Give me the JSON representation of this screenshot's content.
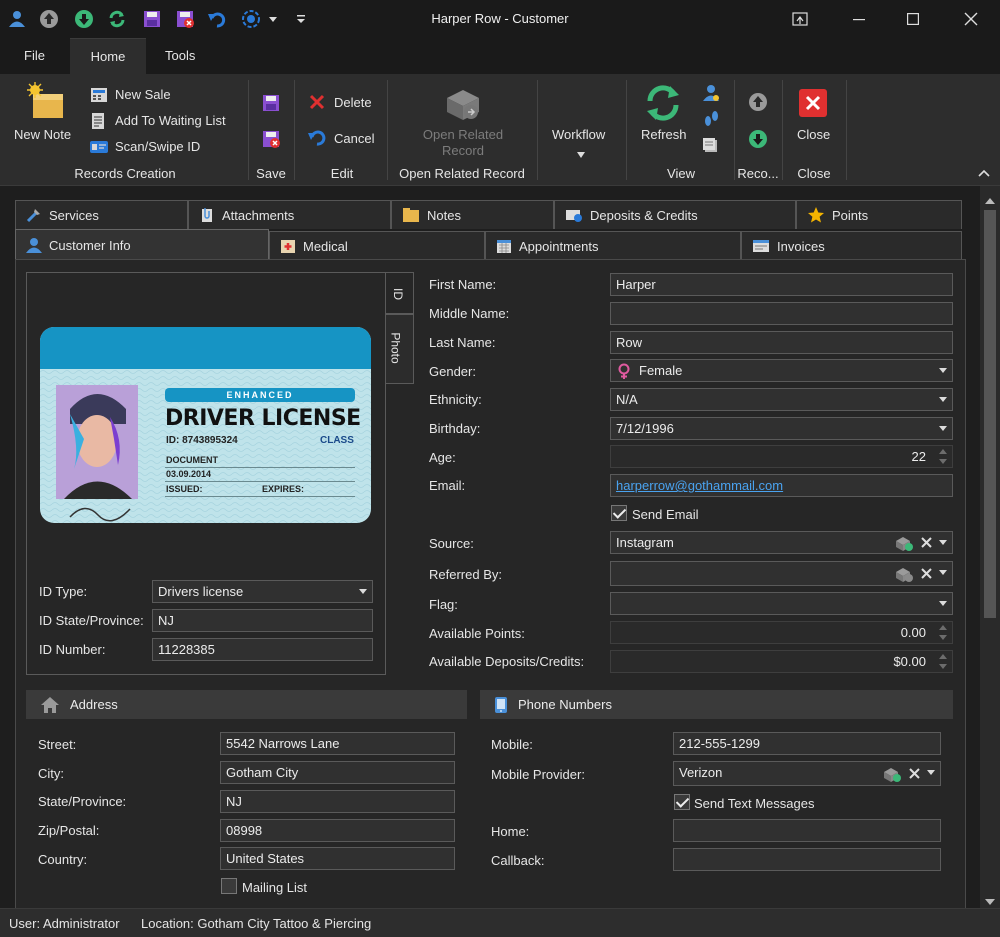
{
  "window": {
    "title": "Harper Row - Customer"
  },
  "menu_tabs": [
    "File",
    "Home",
    "Tools"
  ],
  "ribbon": {
    "new_note": "New Note",
    "new_sale": "New Sale",
    "add_to_waiting_list": "Add To Waiting List",
    "scan_swipe_id": "Scan/Swipe ID",
    "group_records_creation": "Records Creation",
    "group_save": "Save",
    "delete": "Delete",
    "cancel": "Cancel",
    "group_edit": "Edit",
    "open_related_record_line1": "Open Related",
    "open_related_record_line2": "Record",
    "group_open_related_record": "Open Related Record",
    "workflow": "Workflow",
    "refresh": "Refresh",
    "group_view": "View",
    "group_reco": "Reco...",
    "close": "Close",
    "group_close": "Close"
  },
  "tabs_row1": [
    "Services",
    "Attachments",
    "Notes",
    "Deposits & Credits",
    "Points"
  ],
  "tabs_row2": [
    "Customer Info",
    "Medical",
    "Appointments",
    "Invoices"
  ],
  "id_card": {
    "side_tab_id": "ID",
    "side_tab_photo": "Photo",
    "card_enhanced": "ENHANCED",
    "card_title": "DRIVER LICENSE",
    "card_id": "ID: 8743895324",
    "card_class": "CLASS",
    "card_document": "DOCUMENT",
    "card_date": "03.09.2014",
    "card_issued": "ISSUED:",
    "card_expires": "EXPIRES:",
    "id_type_label": "ID Type:",
    "id_type_value": "Drivers license",
    "id_state_label": "ID State/Province:",
    "id_state_value": "NJ",
    "id_number_label": "ID Number:",
    "id_number_value": "11228385"
  },
  "customer": {
    "first_name_label": "First Name:",
    "first_name": "Harper",
    "middle_name_label": "Middle Name:",
    "middle_name": "",
    "last_name_label": "Last Name:",
    "last_name": "Row",
    "gender_label": "Gender:",
    "gender": "Female",
    "ethnicity_label": "Ethnicity:",
    "ethnicity": "N/A",
    "birthday_label": "Birthday:",
    "birthday": "7/12/1996",
    "age_label": "Age:",
    "age": "22",
    "email_label": "Email:",
    "email": "harperrow@gothammail.com",
    "send_email": "Send Email",
    "source_label": "Source:",
    "source": "Instagram",
    "referred_by_label": "Referred By:",
    "referred_by": "",
    "flag_label": "Flag:",
    "flag": "",
    "available_points_label": "Available Points:",
    "available_points": "0.00",
    "available_deposits_label": "Available Deposits/Credits:",
    "available_deposits": "$0.00"
  },
  "address": {
    "header": "Address",
    "street_label": "Street:",
    "street": "5542 Narrows Lane",
    "city_label": "City:",
    "city": "Gotham City",
    "state_label": "State/Province:",
    "state": "NJ",
    "zip_label": "Zip/Postal:",
    "zip": "08998",
    "country_label": "Country:",
    "country": "United States",
    "mailing_list": "Mailing List"
  },
  "phone": {
    "header": "Phone Numbers",
    "mobile_label": "Mobile:",
    "mobile": "212-555-1299",
    "provider_label": "Mobile Provider:",
    "provider": "Verizon",
    "send_text": "Send Text Messages",
    "home_label": "Home:",
    "home": "",
    "callback_label": "Callback:",
    "callback": ""
  },
  "status": {
    "user": "User: Administrator",
    "location": "Location: Gotham City Tattoo & Piercing"
  },
  "colors": {
    "accent_green": "#3cb878",
    "accent_red": "#e03030",
    "card_blue": "#1694c4",
    "link_blue": "#4aa3f0"
  }
}
